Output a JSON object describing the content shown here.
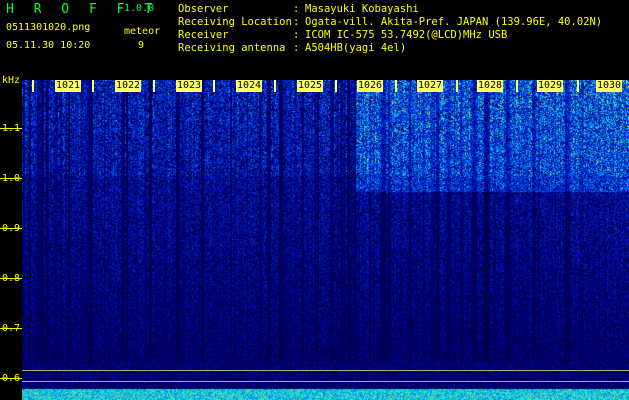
{
  "app": {
    "title": "H R O F F T",
    "version": "1.0.0"
  },
  "file_name": "0511301020.png",
  "timestamp": "05.11.30 10:20",
  "meteor": {
    "label": "meteor",
    "count": "9"
  },
  "info": [
    {
      "label": "Observer",
      "sep": ":",
      "value": "Masayuki Kobayashi"
    },
    {
      "label": "Receiving Location",
      "sep": ":",
      "value": "Ogata-vill. Akita-Pref. JAPAN (139.96E, 40.02N)"
    },
    {
      "label": "Receiver",
      "sep": ":",
      "value": "ICOM IC-575 53.7492(@LCD)MHz USB"
    },
    {
      "label": "Receiving antenna",
      "sep": ":",
      "value": "A504HB(yagi 4el)"
    }
  ],
  "y_axis": {
    "unit": "kHz",
    "ticks": [
      "1.1",
      "1.0",
      "0.9",
      "0.8",
      "0.7",
      "0.6"
    ]
  },
  "x_axis": {
    "ticks": [
      "1021",
      "1022",
      "1023",
      "1024",
      "1025",
      "1026",
      "1027",
      "1028",
      "1029",
      "1030"
    ]
  },
  "colors": {
    "text": "#ffff00",
    "title": "#00ff33",
    "background": "#000000"
  }
}
